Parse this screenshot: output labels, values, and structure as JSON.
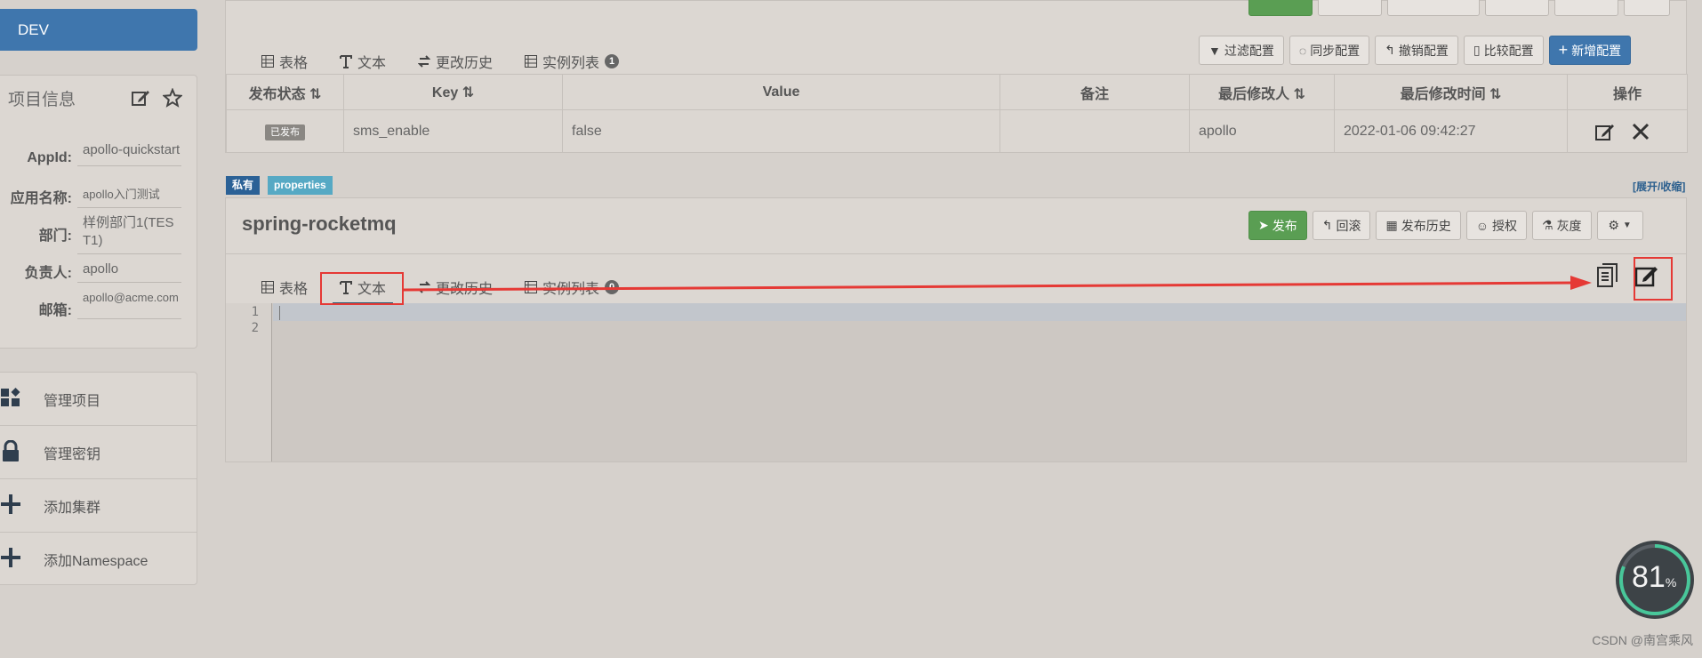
{
  "env": {
    "label": "DEV"
  },
  "project_info": {
    "title": "项目信息",
    "rows": [
      {
        "label": "AppId:",
        "value": "apollo-quickstart"
      },
      {
        "label": "应用名称:",
        "value": "apollo入门测试"
      },
      {
        "label": "部门:",
        "value": "样例部门1(TEST1)"
      },
      {
        "label": "负责人:",
        "value": "apollo"
      },
      {
        "label": "邮箱:",
        "value": "apollo@acme.com"
      }
    ]
  },
  "sidebar_menu": [
    {
      "label": "管理项目",
      "icon": "grid-icon"
    },
    {
      "label": "管理密钥",
      "icon": "lock-icon"
    },
    {
      "label": "添加集群",
      "icon": "plus-icon"
    },
    {
      "label": "添加Namespace",
      "icon": "plus-icon"
    }
  ],
  "ns1": {
    "tabs": [
      {
        "label": "表格",
        "active": true
      },
      {
        "label": "文本"
      },
      {
        "label": "更改历史"
      },
      {
        "label": "实例列表",
        "badge": "1"
      }
    ],
    "actions": [
      "过滤配置",
      "同步配置",
      "撤销配置",
      "比较配置",
      "新增配置"
    ],
    "table": {
      "headers": [
        "发布状态",
        "Key",
        "Value",
        "备注",
        "最后修改人",
        "最后修改时间",
        "操作"
      ],
      "row": {
        "status": "已发布",
        "key": "sms_enable",
        "value": "false",
        "comment": "",
        "modifier": "apollo",
        "time": "2022-01-06 09:42:27"
      }
    }
  },
  "ns2": {
    "tag_private": "私有",
    "tag_format": "properties",
    "toggle": "[展开/收缩]",
    "name": "spring-rocketmq",
    "buttons": [
      "发布",
      "回滚",
      "发布历史",
      "授权",
      "灰度"
    ],
    "tabs": [
      {
        "label": "表格"
      },
      {
        "label": "文本",
        "active": true
      },
      {
        "label": "更改历史"
      },
      {
        "label": "实例列表",
        "badge": "0"
      }
    ],
    "line_numbers": [
      "1",
      "2"
    ]
  },
  "gauge": {
    "value": "81",
    "unit": "%"
  },
  "watermark": "CSDN @南宫乘风",
  "colors": {
    "primary": "#3f76ad",
    "success": "#5a9e53",
    "annotation": "#e53935"
  }
}
